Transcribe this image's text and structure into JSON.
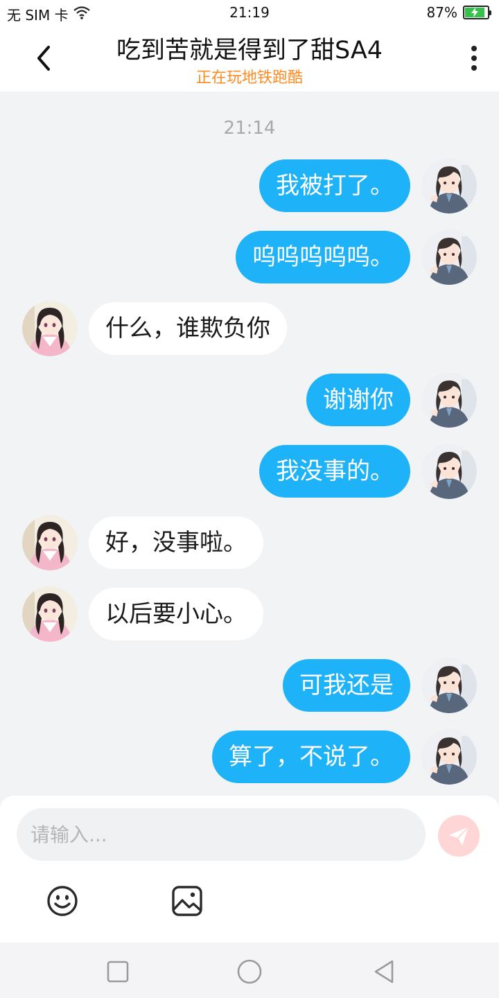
{
  "status_bar": {
    "carrier": "无 SIM 卡",
    "time": "21:19",
    "battery": "87%",
    "battery_level": 0.87
  },
  "header": {
    "title": "吃到苦就是得到了甜SA4",
    "subtitle": "正在玩地铁跑酷"
  },
  "chat": {
    "timestamp": "21:14",
    "messages": [
      {
        "from": "me",
        "text": "我被打了。"
      },
      {
        "from": "me",
        "text": "呜呜呜呜呜。"
      },
      {
        "from": "other",
        "text": "什么，谁欺负你"
      },
      {
        "from": "me",
        "text": "谢谢你"
      },
      {
        "from": "me",
        "text": "我没事的。"
      },
      {
        "from": "other",
        "text": "好，没事啦。"
      },
      {
        "from": "other",
        "text": "以后要小心。"
      },
      {
        "from": "me",
        "text": "可我还是"
      },
      {
        "from": "me",
        "text": "算了，不说了。"
      }
    ]
  },
  "input": {
    "placeholder": "请输入..."
  },
  "icons": {
    "back": "chevron-left-icon",
    "more": "more-vertical-icon",
    "send": "send-icon",
    "emoji": "emoji-icon",
    "image": "image-icon",
    "wifi": "wifi-icon"
  },
  "colors": {
    "my_bubble": "#1eb2f8",
    "other_bubble": "#ffffff",
    "subtitle": "#ff8a1f",
    "background": "#f2f3f5"
  }
}
